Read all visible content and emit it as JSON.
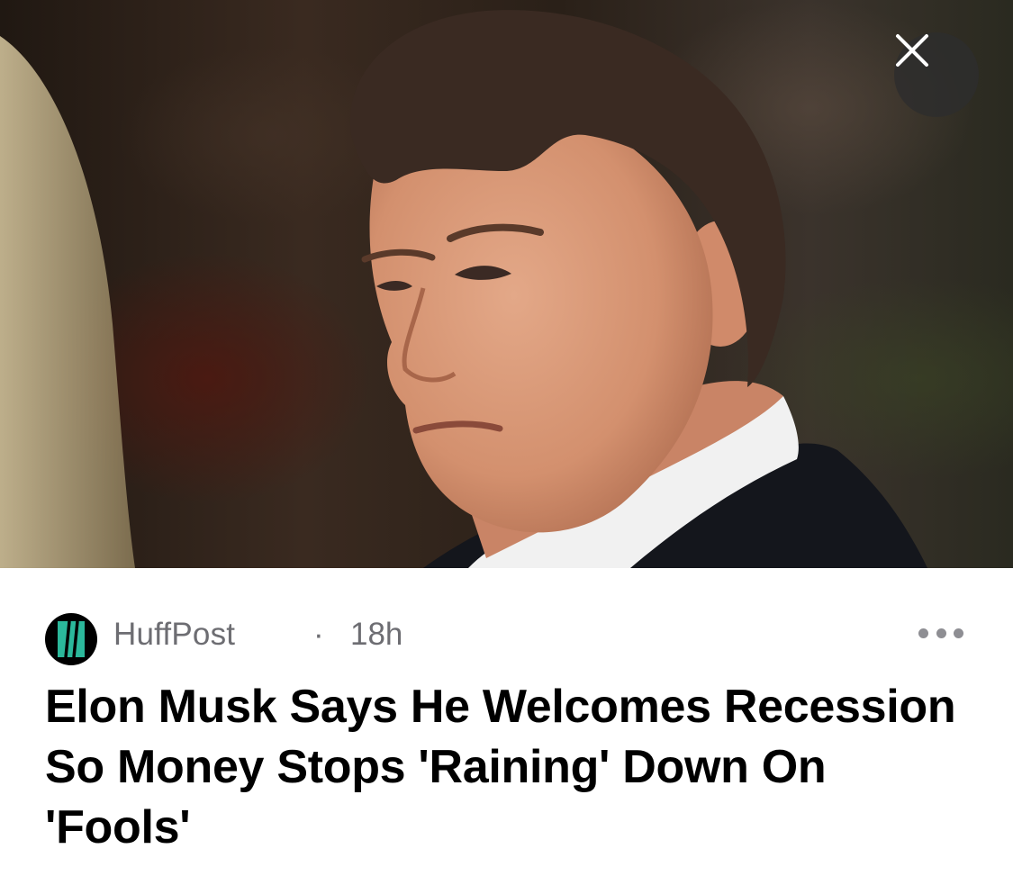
{
  "hero_image": {
    "alt": "",
    "colors": {
      "skin": "#d99a7c",
      "hair": "#3a2a22",
      "shirt": "#f2f2f2",
      "jacket": "#111318"
    }
  },
  "close_button": {
    "icon": "close-icon"
  },
  "source": {
    "logo_icon": "huffpost-logo-icon",
    "logo_color": "#2bb89b",
    "name": "HuffPost",
    "separator": "·",
    "time": "18h"
  },
  "more_button": {
    "icon": "more-horizontal-icon"
  },
  "article": {
    "headline": "Elon Musk Says He Welcomes Recession So Money Stops 'Raining' Down On 'Fools'"
  }
}
